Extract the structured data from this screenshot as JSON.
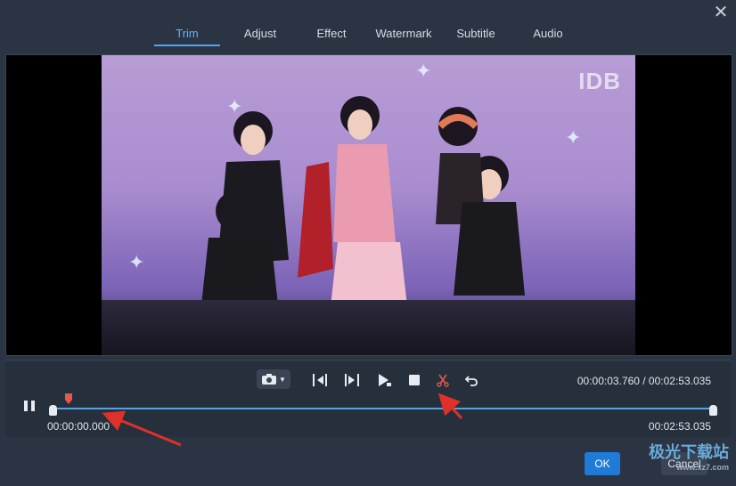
{
  "window": {
    "close_icon": "close-icon"
  },
  "tabs": [
    {
      "label": "Trim",
      "active": true
    },
    {
      "label": "Adjust",
      "active": false
    },
    {
      "label": "Effect",
      "active": false
    },
    {
      "label": "Watermark",
      "active": false
    },
    {
      "label": "Subtitle",
      "active": false
    },
    {
      "label": "Audio",
      "active": false
    }
  ],
  "video": {
    "overlay_text": "IDB"
  },
  "toolbar": {
    "icons": [
      "camera-icon",
      "set-start-icon",
      "set-end-icon",
      "play-segment-icon",
      "stop-icon",
      "scissors-icon",
      "undo-icon"
    ]
  },
  "playback": {
    "current_time": "00:00:03.760",
    "total_time": "00:02:53.035",
    "time_readout": "00:00:03.760 / 00:02:53.035",
    "start_time": "00:00:00.000",
    "end_time": "00:02:53.035",
    "progress_fraction": 0.0217,
    "state_icon": "pause-icon"
  },
  "footer": {
    "ok_label": "OK",
    "cancel_label": "Cancel"
  },
  "corner_watermark": {
    "title": "极光下载站",
    "subtitle": "www.xz7.com"
  },
  "colors": {
    "accent": "#4aa6ff",
    "playhead": "#e8564a",
    "annotation": "#e0302a",
    "ok": "#1f7bd8"
  }
}
